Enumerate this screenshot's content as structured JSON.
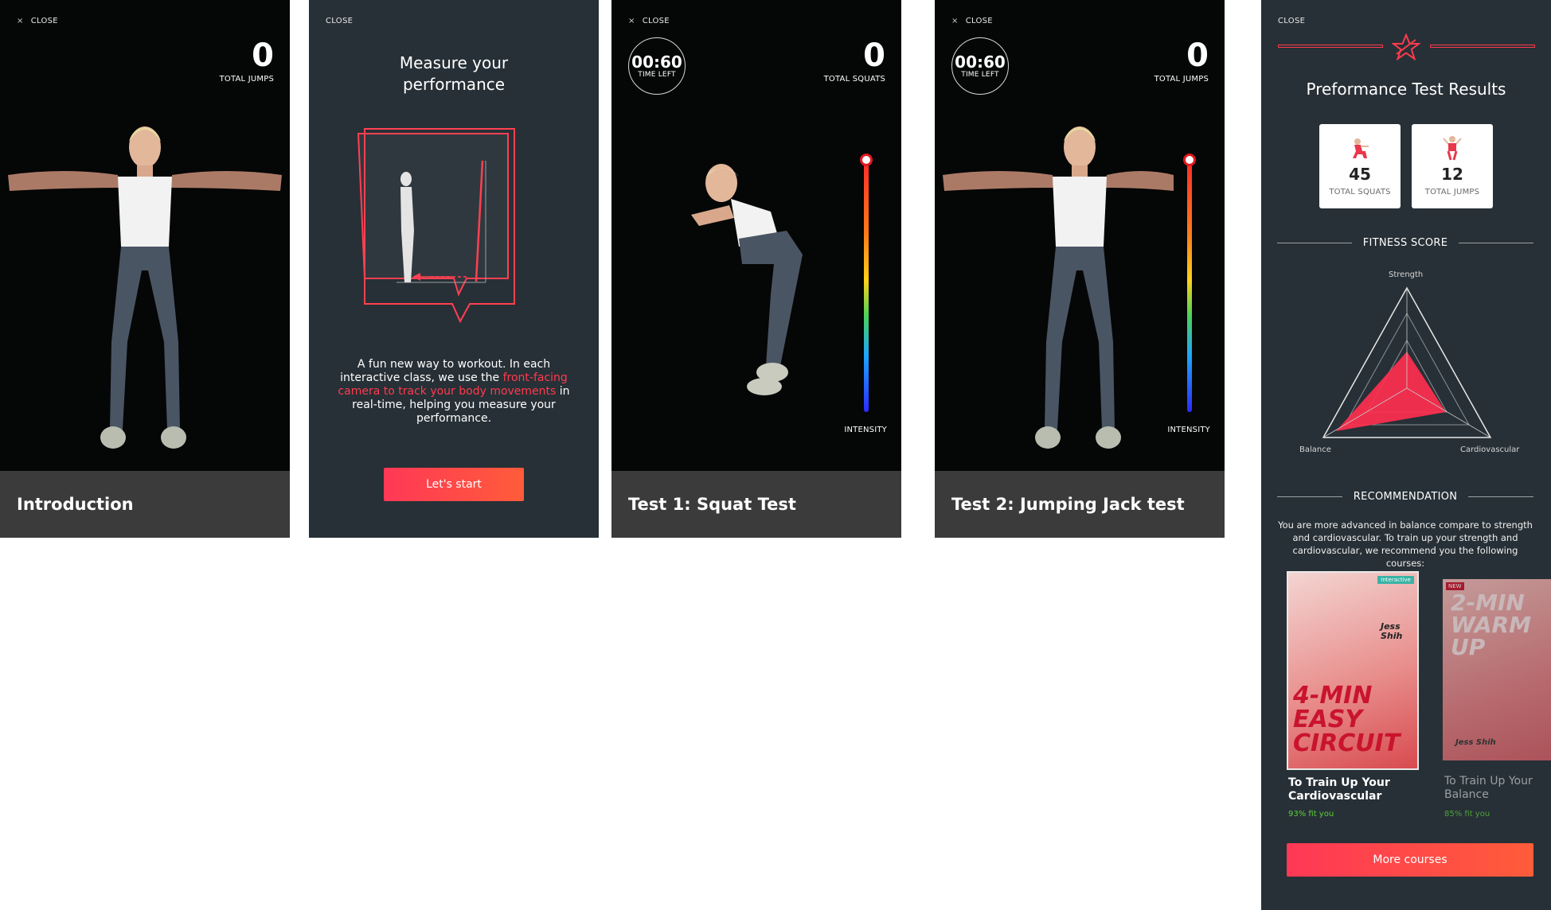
{
  "panel_intro": {
    "close_label": "CLOSE",
    "counter_value": "0",
    "counter_label": "TOTAL JUMPS",
    "caption": "Introduction"
  },
  "panel_measure": {
    "close_label": "CLOSE",
    "heading_line1": "Measure your",
    "heading_line2": "performance",
    "desc_part1": "A fun new way to workout. In each interactive class, we use the ",
    "desc_highlight": "front-facing camera to track your body movements",
    "desc_part2": " in real-time, helping you measure your performance.",
    "start_button": "Let's start",
    "accent": "#ff3b4e"
  },
  "panel_squat": {
    "close_label": "CLOSE",
    "timer_value": "00:60",
    "timer_label": "TIME LEFT",
    "counter_value": "0",
    "counter_label": "TOTAL SQUATS",
    "intensity_label": "INTENSITY",
    "caption": "Test 1: Squat Test"
  },
  "panel_jump": {
    "close_label": "CLOSE",
    "timer_value": "00:60",
    "timer_label": "TIME LEFT",
    "counter_value": "0",
    "counter_label": "TOTAL JUMPS",
    "intensity_label": "INTENSITY",
    "caption": "Test 2: Jumping Jack test"
  },
  "panel_results": {
    "close_label": "CLOSE",
    "title": "Preformance Test Results",
    "stats": [
      {
        "value": "45",
        "label": "TOTAL SQUATS",
        "icon": "squat-icon"
      },
      {
        "value": "12",
        "label": "TOTAL JUMPS",
        "icon": "jump-icon"
      }
    ],
    "fitness_heading": "FITNESS SCORE",
    "radar": {
      "labels": [
        "Strength",
        "Balance",
        "Cardiovascular"
      ]
    },
    "recommendation_heading": "RECOMMENDATION",
    "recommendation_text": "You are more advanced in balance compare to strength and cardiovascular. To train up your strength and cardiovascular, we recommend you the following courses:",
    "courses": [
      {
        "title": "To Train Up Your Cardiovascular",
        "fit": "93% fit you",
        "poster_text": "4-MIN EASY CIRCUIT",
        "coach": "Jess Shih",
        "tag": "Interactive"
      },
      {
        "title": "To Train Up Your Balance",
        "fit": "85% fit you",
        "poster_text": "2-MIN WARM UP",
        "coach": "Jess Shih",
        "tag": "NEW"
      }
    ],
    "more_button": "More courses",
    "accent": "#ff3b4e"
  }
}
